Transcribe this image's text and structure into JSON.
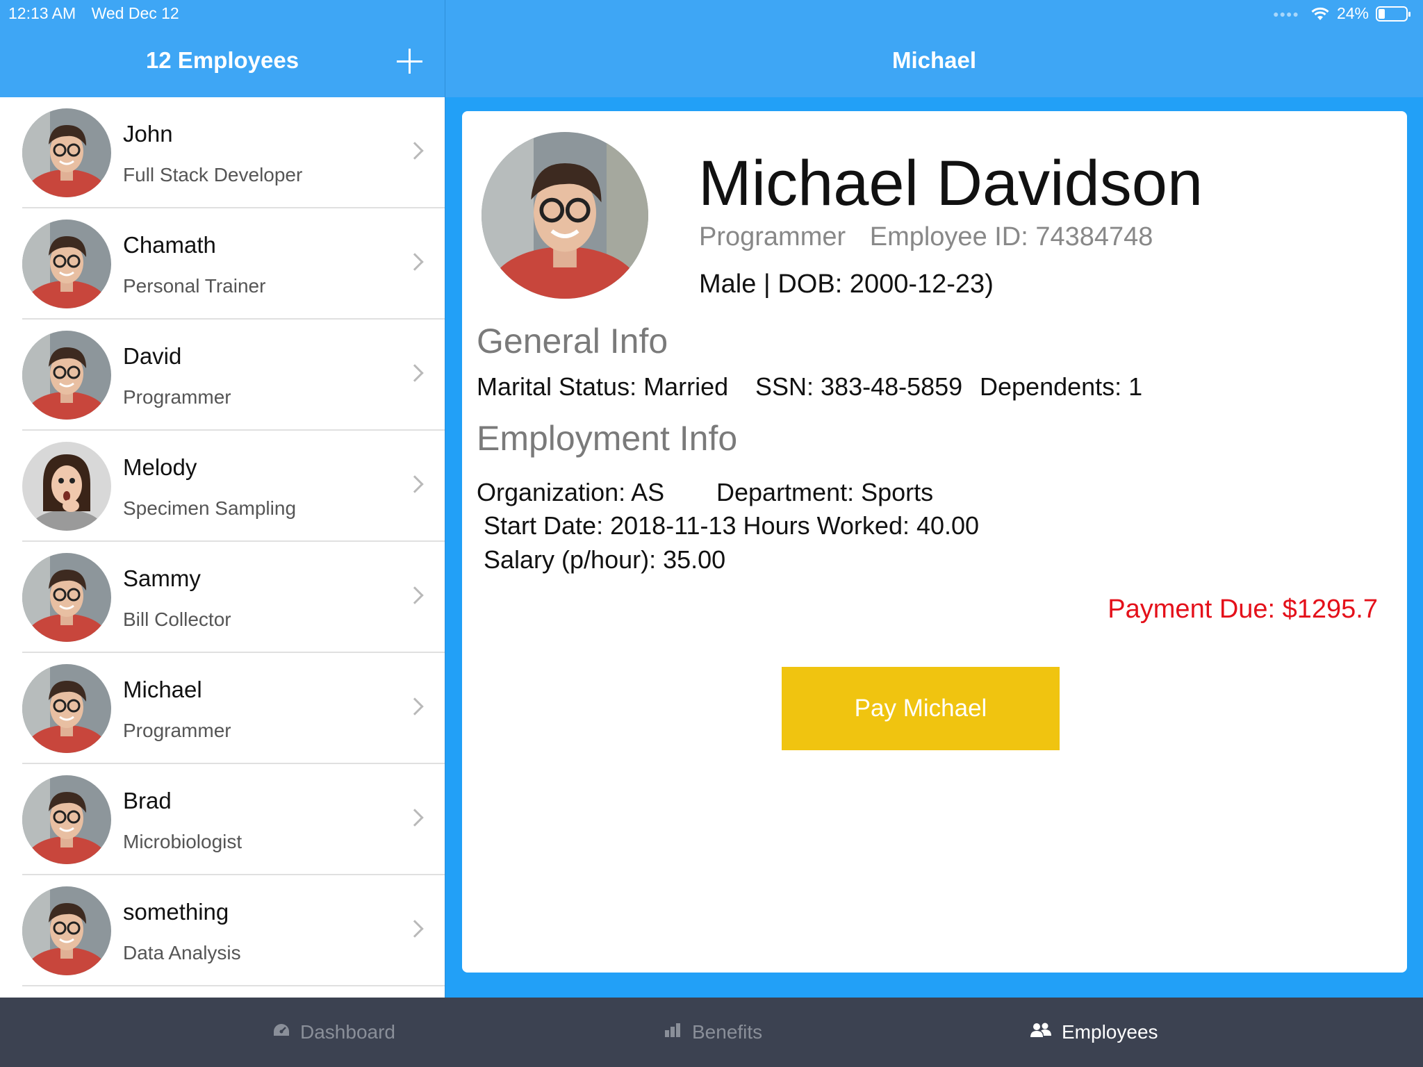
{
  "status_bar": {
    "time": "12:13 AM",
    "date": "Wed Dec 12",
    "battery": "24%"
  },
  "list_header": {
    "title": "12 Employees"
  },
  "detail_header": {
    "title": "Michael"
  },
  "employees": [
    {
      "name": "John",
      "role": "Full Stack Developer"
    },
    {
      "name": "Chamath",
      "role": "Personal Trainer"
    },
    {
      "name": "David",
      "role": "Programmer"
    },
    {
      "name": "Melody",
      "role": "Specimen Sampling"
    },
    {
      "name": "Sammy",
      "role": "Bill Collector"
    },
    {
      "name": "Michael",
      "role": "Programmer"
    },
    {
      "name": "Brad",
      "role": "Microbiologist"
    },
    {
      "name": "something",
      "role": "Data Analysis"
    }
  ],
  "detail": {
    "full_name": "Michael Davidson",
    "position": "Programmer",
    "employee_id": "Employee ID: 74384748",
    "gender_dob": "Male | DOB: 2000-12-23)",
    "general_title": "General Info",
    "marital": "Marital Status: Married",
    "ssn": "SSN: 383-48-5859",
    "dependents": "Dependents: 1",
    "employment_title": "Employment Info",
    "organization": "Organization: AS",
    "department": "Department: Sports",
    "start_hours": "Start Date: 2018-11-13 Hours Worked: 40.00",
    "salary": "Salary (p/hour): 35.00",
    "payment_due": "Payment Due: $1295.7",
    "pay_button": "Pay Michael"
  },
  "tabs": [
    {
      "label": "Dashboard",
      "icon": "dashboard-icon"
    },
    {
      "label": "Benefits",
      "icon": "bar-chart-icon"
    },
    {
      "label": "Employees",
      "icon": "people-icon"
    }
  ],
  "colors": {
    "header_blue": "#3ea6f5",
    "detail_blue": "#22a0f7",
    "pay_button": "#f0c410",
    "payment_due": "#e4101a",
    "tabbar": "#3c4251"
  }
}
